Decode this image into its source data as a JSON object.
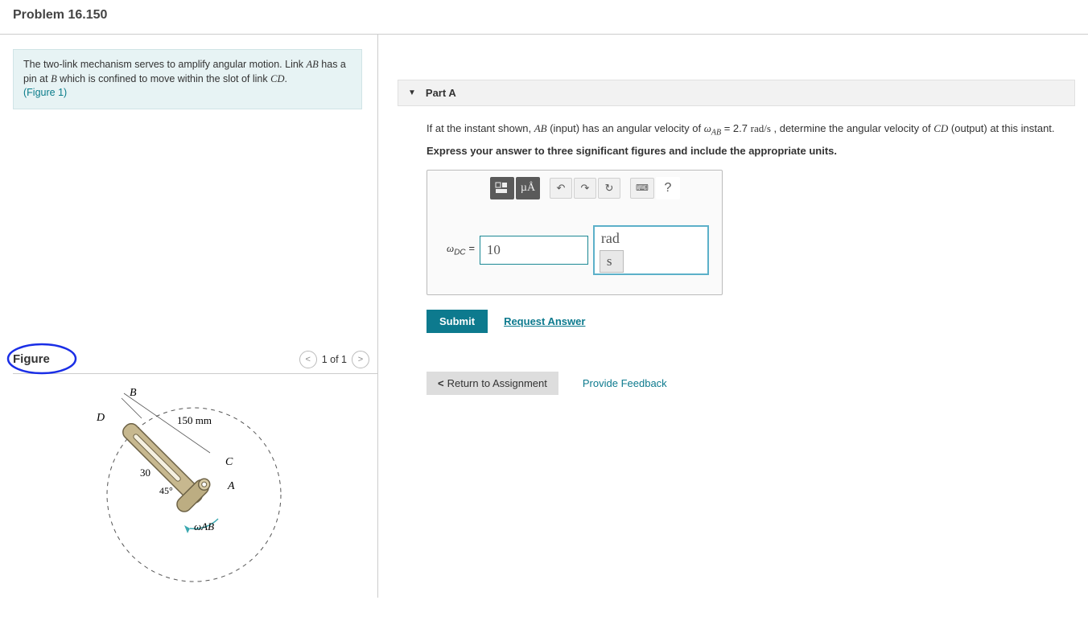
{
  "header": {
    "problem_title": "Problem 16.150"
  },
  "prompt": {
    "line1": "The two-link mechanism serves to amplify angular motion. Link ",
    "ab": "AB",
    "line2": " has a pin at ",
    "b": "B",
    "line3": " which is confined to move within the slot of link ",
    "cd": "CD",
    "line4": ".",
    "figlink": "(Figure 1)"
  },
  "figure": {
    "title": "Figure",
    "pager": "1 of 1",
    "labels": {
      "B": "B",
      "D": "D",
      "C": "C",
      "A": "A",
      "len": "150 mm",
      "ang30": "30",
      "ang45": "45°",
      "omega": "ωAB"
    }
  },
  "partA": {
    "label": "Part A",
    "q1": "If at the instant shown, ",
    "q_ab": "AB",
    "q2": " (input) has an angular velocity of ",
    "q_omega": "ω",
    "q_sub": "AB",
    "q3": " = 2.7 ",
    "q_rads": "rad/s",
    "q4": " , determine the angular velocity of ",
    "q_cd": "CD",
    "q5": " (output) at this instant.",
    "instruct": "Express your answer to three significant figures and include the appropriate units.",
    "toolbar": {
      "templates": "⬚",
      "units": "µÅ",
      "undo": "↶",
      "redo": "↷",
      "reset": "↻",
      "keyboard": "⌨",
      "help": "?"
    },
    "answer": {
      "label_omega": "ω",
      "label_sub": "DC",
      "label_eq": " = ",
      "value": "10",
      "unit_top": "rad",
      "unit_bot": "s"
    },
    "submit": "Submit",
    "request_answer": "Request Answer"
  },
  "footer": {
    "return": "Return to Assignment",
    "feedback": "Provide Feedback"
  }
}
